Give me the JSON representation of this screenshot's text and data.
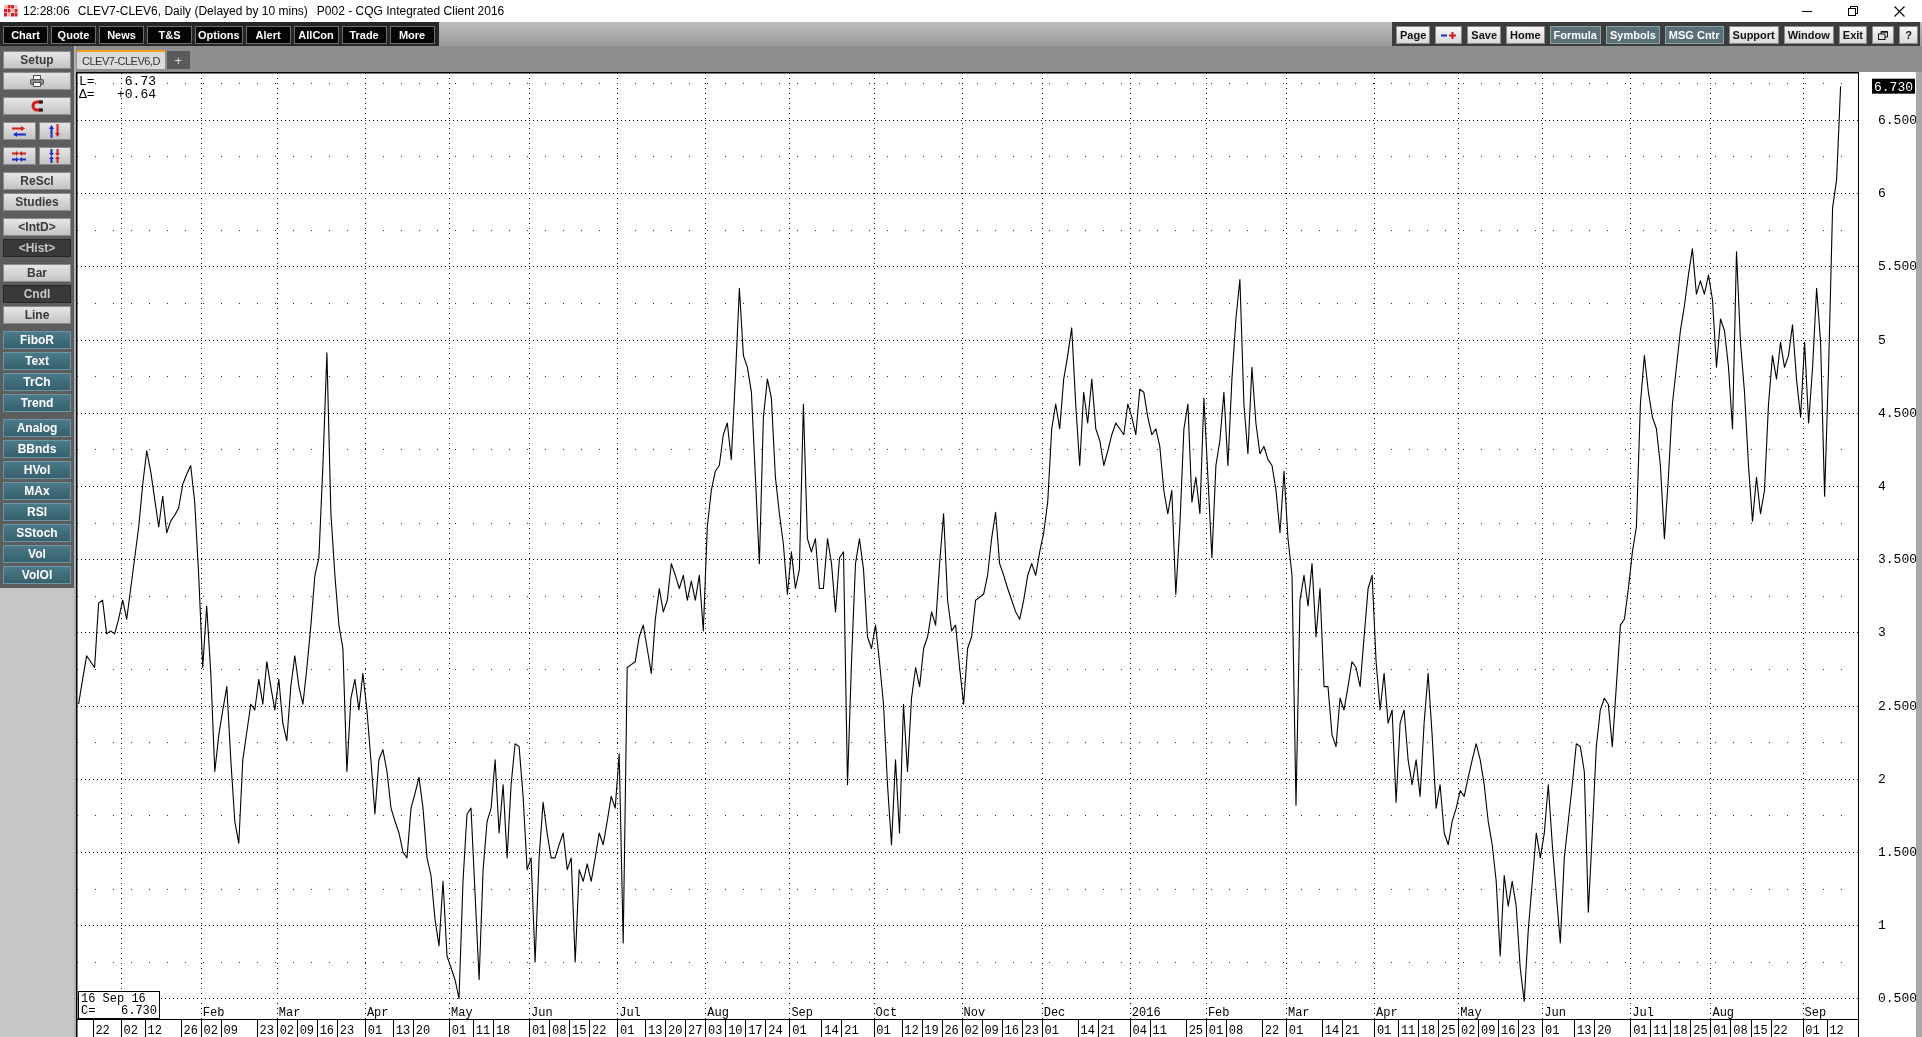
{
  "window": {
    "time": "12:28:06",
    "title": "CLEV7-CLEV6, Daily (Delayed by 10 mins)",
    "app": "P002 - CQG Integrated Client 2016"
  },
  "menu": [
    "Chart",
    "Quote",
    "News",
    "T&S",
    "Options",
    "Alert",
    "AllCon",
    "Trade",
    "More"
  ],
  "toolbar": [
    {
      "kind": "text",
      "label": "Page",
      "active": false
    },
    {
      "kind": "icon",
      "active": false
    },
    {
      "kind": "text",
      "label": "Save",
      "active": false
    },
    {
      "kind": "text",
      "label": "Home",
      "active": false
    },
    {
      "kind": "text",
      "label": "Formula",
      "active": true
    },
    {
      "kind": "text",
      "label": "Symbols",
      "active": true
    },
    {
      "kind": "text",
      "label": "MSG Cntr",
      "active": true
    },
    {
      "kind": "text",
      "label": "Support",
      "active": false
    },
    {
      "kind": "text",
      "label": "Window",
      "active": false
    },
    {
      "kind": "text",
      "label": "Exit",
      "active": false
    },
    {
      "kind": "icon",
      "active": false
    },
    {
      "kind": "text",
      "label": "?",
      "active": false
    }
  ],
  "tabs": [
    {
      "label": "CLEV7-CLEV6,D",
      "selected": true
    }
  ],
  "new_tab": "+",
  "sidebar": [
    {
      "kind": "plain",
      "buttons": [
        {
          "kind": "text",
          "label": "Setup"
        },
        {
          "kind": "icon"
        }
      ]
    },
    {
      "kind": "plain",
      "buttons": [
        {
          "kind": "icon"
        }
      ]
    },
    {
      "kind": "row",
      "buttons": [
        {
          "kind": "icon"
        },
        {
          "kind": "icon"
        }
      ]
    },
    {
      "kind": "row",
      "buttons": [
        {
          "kind": "icon"
        },
        {
          "kind": "icon"
        }
      ]
    },
    {
      "kind": "plain",
      "buttons": [
        {
          "kind": "text",
          "label": "ReScl"
        },
        {
          "kind": "text",
          "label": "Studies"
        }
      ]
    },
    {
      "kind": "mode",
      "buttons": [
        {
          "kind": "text",
          "label": "<IntD>",
          "selected": false
        },
        {
          "kind": "text",
          "label": "<Hist>",
          "selected": true
        }
      ]
    },
    {
      "kind": "mode",
      "buttons": [
        {
          "kind": "text",
          "label": "Bar",
          "selected": false
        },
        {
          "kind": "text",
          "label": "Cndl",
          "selected": true
        },
        {
          "kind": "text",
          "label": "Line",
          "selected": false
        }
      ]
    },
    {
      "kind": "tool",
      "buttons": [
        {
          "kind": "text",
          "label": "FiboR"
        },
        {
          "kind": "text",
          "label": "Text"
        },
        {
          "kind": "text",
          "label": "TrCh"
        },
        {
          "kind": "text",
          "label": "Trend"
        }
      ]
    },
    {
      "kind": "tool",
      "buttons": [
        {
          "kind": "text",
          "label": "Analog"
        },
        {
          "kind": "text",
          "label": "BBnds"
        },
        {
          "kind": "text",
          "label": "HVol"
        },
        {
          "kind": "text",
          "label": "MAx"
        },
        {
          "kind": "text",
          "label": "RSI"
        },
        {
          "kind": "text",
          "label": "SStoch"
        },
        {
          "kind": "text",
          "label": "Vol"
        },
        {
          "kind": "text",
          "label": "VolOI"
        }
      ]
    }
  ],
  "chart": {
    "readout": [
      {
        "label": "L=",
        "value": "6.73"
      },
      {
        "label": "Δ=",
        "value": "+0.64"
      }
    ],
    "cursor": {
      "date": "16 Sep 16",
      "label": "C=",
      "value": "6.730"
    },
    "last_price": "6.730",
    "chart_data": {
      "type": "line",
      "grid": true,
      "categories": [
        null,
        null,
        null,
        null,
        null,
        null,
        "22",
        null,
        null,
        null,
        null,
        null,
        null,
        "02",
        null,
        null,
        null,
        null,
        null,
        "12",
        null,
        null,
        null,
        null,
        null,
        null,
        null,
        null,
        "26",
        null,
        null,
        null,
        null,
        "02",
        null,
        null,
        null,
        null,
        "09",
        null,
        null,
        null,
        null,
        null,
        null,
        null,
        null,
        "23",
        null,
        null,
        null,
        null,
        "02",
        null,
        null,
        null,
        null,
        "09",
        null,
        null,
        null,
        null,
        "16",
        null,
        null,
        null,
        null,
        "23",
        null,
        null,
        null,
        null,
        null,
        null,
        "01",
        null,
        null,
        null,
        null,
        null,
        null,
        "13",
        null,
        null,
        null,
        null,
        "20",
        null,
        null,
        null,
        null,
        null,
        null,
        null,
        null,
        "01",
        null,
        null,
        null,
        null,
        null,
        "11",
        null,
        null,
        null,
        null,
        "18",
        null,
        null,
        null,
        null,
        null,
        null,
        null,
        null,
        "01",
        null,
        null,
        null,
        null,
        "08",
        null,
        null,
        null,
        null,
        "15",
        null,
        null,
        null,
        null,
        "22",
        null,
        null,
        null,
        null,
        null,
        null,
        "01",
        null,
        null,
        null,
        null,
        null,
        null,
        "13",
        null,
        null,
        null,
        null,
        "20",
        null,
        null,
        null,
        null,
        "27",
        null,
        null,
        null,
        null,
        "03",
        null,
        null,
        null,
        null,
        "10",
        null,
        null,
        null,
        null,
        "17",
        null,
        null,
        null,
        null,
        "24",
        null,
        null,
        null,
        null,
        null,
        "01",
        null,
        null,
        null,
        null,
        null,
        null,
        null,
        "14",
        null,
        null,
        null,
        null,
        "21",
        null,
        null,
        null,
        null,
        null,
        null,
        null,
        "01",
        null,
        null,
        null,
        null,
        null,
        null,
        "12",
        null,
        null,
        null,
        null,
        "19",
        null,
        null,
        null,
        null,
        "26",
        null,
        null,
        null,
        null,
        "02",
        null,
        null,
        null,
        null,
        "09",
        null,
        null,
        null,
        null,
        "16",
        null,
        null,
        null,
        null,
        "23",
        null,
        null,
        null,
        null,
        "01",
        null,
        null,
        null,
        null,
        null,
        null,
        null,
        null,
        "14",
        null,
        null,
        null,
        null,
        "21",
        null,
        null,
        null,
        null,
        null,
        null,
        null,
        "04",
        null,
        null,
        null,
        null,
        "11",
        null,
        null,
        null,
        null,
        null,
        null,
        null,
        null,
        "25",
        null,
        null,
        null,
        null,
        "01",
        null,
        null,
        null,
        null,
        "08",
        null,
        null,
        null,
        null,
        null,
        null,
        null,
        null,
        "22",
        null,
        null,
        null,
        null,
        null,
        "01",
        null,
        null,
        null,
        null,
        null,
        null,
        null,
        null,
        "14",
        null,
        null,
        null,
        null,
        "21",
        null,
        null,
        null,
        null,
        null,
        null,
        null,
        "01",
        null,
        null,
        null,
        null,
        null,
        "11",
        null,
        null,
        null,
        null,
        "18",
        null,
        null,
        null,
        null,
        "25",
        null,
        null,
        null,
        null,
        "02",
        null,
        null,
        null,
        null,
        "09",
        null,
        null,
        null,
        null,
        "16",
        null,
        null,
        null,
        null,
        "23",
        null,
        null,
        null,
        null,
        null,
        "01",
        null,
        null,
        null,
        null,
        null,
        null,
        null,
        "13",
        null,
        null,
        null,
        null,
        "20",
        null,
        null,
        null,
        null,
        null,
        null,
        null,
        null,
        "01",
        null,
        null,
        null,
        null,
        "11",
        null,
        null,
        null,
        null,
        "18",
        null,
        null,
        null,
        null,
        "25",
        null,
        null,
        null,
        null,
        "01",
        null,
        null,
        null,
        null,
        "08",
        null,
        null,
        null,
        null,
        "15",
        null,
        null,
        null,
        null,
        "22",
        null,
        null,
        null,
        null,
        null,
        null,
        null,
        "01",
        null,
        null,
        null,
        null,
        null,
        "12",
        null
      ],
      "values": [
        2.51,
        2.68,
        2.84,
        2.8,
        2.76,
        3.2,
        3.22,
        2.99,
        3.01,
        2.99,
        3.09,
        3.22,
        3.09,
        3.3,
        3.51,
        3.72,
        4.01,
        4.24,
        4.1,
        3.91,
        3.72,
        3.93,
        3.68,
        3.76,
        3.8,
        3.85,
        4.01,
        4.08,
        4.14,
        3.89,
        3.39,
        2.76,
        3.18,
        2.72,
        2.05,
        2.3,
        2.47,
        2.63,
        2.13,
        1.71,
        1.56,
        2.13,
        2.32,
        2.51,
        2.47,
        2.68,
        2.51,
        2.8,
        2.63,
        2.47,
        2.68,
        2.38,
        2.26,
        2.63,
        2.84,
        2.63,
        2.51,
        2.76,
        3.05,
        3.39,
        3.51,
        4.14,
        4.91,
        3.81,
        3.39,
        3.05,
        2.89,
        2.05,
        2.55,
        2.68,
        2.47,
        2.72,
        2.47,
        2.13,
        1.76,
        2.13,
        2.2,
        2.05,
        1.8,
        1.71,
        1.63,
        1.5,
        1.46,
        1.8,
        1.9,
        2.01,
        1.8,
        1.46,
        1.34,
        1.04,
        0.86,
        1.3,
        0.79,
        0.71,
        0.63,
        0.5,
        1.3,
        1.76,
        1.8,
        1.21,
        0.63,
        1.38,
        1.71,
        1.8,
        2.13,
        1.63,
        1.96,
        1.46,
        1.96,
        2.24,
        2.22,
        1.88,
        1.38,
        1.46,
        0.75,
        1.46,
        1.84,
        1.63,
        1.46,
        1.46,
        1.55,
        1.63,
        1.38,
        1.46,
        0.75,
        1.38,
        1.3,
        1.42,
        1.3,
        1.46,
        1.63,
        1.55,
        1.71,
        1.88,
        1.8,
        2.17,
        0.88,
        2.76,
        2.78,
        2.8,
        2.97,
        3.05,
        2.89,
        2.72,
        3.09,
        3.3,
        3.14,
        3.22,
        3.47,
        3.39,
        3.3,
        3.39,
        3.22,
        3.35,
        3.22,
        3.39,
        3.01,
        3.72,
        3.97,
        4.1,
        4.14,
        4.35,
        4.43,
        4.18,
        4.73,
        5.35,
        4.89,
        4.81,
        4.64,
        4.06,
        3.47,
        4.47,
        4.73,
        4.6,
        4.06,
        3.81,
        3.6,
        3.26,
        3.55,
        3.3,
        3.43,
        4.56,
        3.64,
        3.55,
        3.64,
        3.3,
        3.3,
        3.64,
        3.47,
        3.14,
        3.51,
        3.55,
        1.96,
        2.8,
        3.47,
        3.64,
        3.43,
        2.97,
        2.89,
        3.05,
        2.8,
        2.51,
        1.96,
        1.55,
        2.13,
        1.63,
        2.51,
        2.05,
        2.55,
        2.76,
        2.63,
        2.89,
        2.97,
        3.14,
        3.05,
        3.47,
        3.81,
        3.22,
        3.01,
        3.05,
        2.76,
        2.51,
        2.89,
        2.97,
        3.22,
        3.24,
        3.26,
        3.39,
        3.64,
        3.82,
        3.47,
        3.39,
        3.3,
        3.22,
        3.14,
        3.09,
        3.22,
        3.39,
        3.47,
        3.39,
        3.55,
        3.68,
        3.89,
        4.39,
        4.56,
        4.39,
        4.73,
        4.89,
        5.08,
        4.56,
        4.14,
        4.64,
        4.43,
        4.73,
        4.39,
        4.31,
        4.14,
        4.24,
        4.35,
        4.43,
        4.39,
        4.35,
        4.56,
        4.47,
        4.35,
        4.66,
        4.64,
        4.47,
        4.35,
        4.39,
        4.27,
        3.97,
        3.81,
        3.97,
        3.26,
        3.72,
        4.39,
        4.56,
        3.89,
        4.06,
        3.81,
        4.6,
        4.06,
        3.51,
        4.14,
        4.31,
        4.64,
        4.14,
        4.73,
        5.14,
        5.41,
        4.56,
        4.22,
        4.81,
        4.43,
        4.22,
        4.27,
        4.18,
        4.14,
        3.97,
        3.68,
        4.1,
        3.64,
        3.39,
        1.82,
        3.22,
        3.39,
        3.18,
        3.47,
        2.97,
        3.3,
        2.63,
        2.63,
        2.3,
        2.22,
        2.55,
        2.47,
        2.63,
        2.8,
        2.76,
        2.63,
        2.97,
        3.3,
        3.39,
        2.8,
        2.47,
        2.72,
        2.38,
        2.47,
        1.84,
        2.38,
        2.47,
        2.13,
        1.96,
        2.13,
        1.88,
        2.38,
        2.72,
        2.3,
        1.8,
        1.96,
        1.63,
        1.55,
        1.71,
        1.8,
        1.92,
        1.88,
        2.01,
        2.13,
        2.24,
        2.13,
        1.96,
        1.71,
        1.55,
        1.3,
        0.79,
        1.34,
        1.13,
        1.3,
        1.13,
        0.71,
        0.48,
        0.96,
        1.3,
        1.63,
        1.46,
        1.63,
        1.96,
        1.55,
        1.21,
        0.88,
        1.46,
        1.71,
        1.96,
        2.24,
        2.22,
        2.05,
        1.09,
        1.63,
        2.22,
        2.47,
        2.55,
        2.51,
        2.22,
        2.63,
        3.05,
        3.09,
        3.3,
        3.55,
        3.72,
        4.56,
        4.89,
        4.64,
        4.47,
        4.39,
        4.14,
        3.64,
        4.06,
        4.56,
        4.81,
        5.06,
        5.23,
        5.44,
        5.62,
        5.31,
        5.4,
        5.31,
        5.44,
        5.27,
        4.81,
        5.14,
        5.06,
        4.81,
        4.39,
        5.6,
        4.98,
        4.64,
        4.14,
        3.76,
        4.06,
        3.81,
        3.97,
        4.56,
        4.89,
        4.73,
        4.98,
        4.81,
        4.89,
        5.1,
        4.73,
        4.47,
        4.98,
        4.43,
        4.81,
        5.35,
        4.98,
        3.93,
        4.81,
        5.9,
        6.09,
        6.73
      ],
      "ylim": [
        0.36,
        6.82
      ],
      "yticks": [
        {
          "value": 0.5,
          "label": "0.500"
        },
        {
          "value": 1,
          "label": "1"
        },
        {
          "value": 1.5,
          "label": "1.500"
        },
        {
          "value": 2,
          "label": "2"
        },
        {
          "value": 2.5,
          "label": "2.500"
        },
        {
          "value": 3,
          "label": "3"
        },
        {
          "value": 3.5,
          "label": "3.500"
        },
        {
          "value": 4,
          "label": "4"
        },
        {
          "value": 4.5,
          "label": "4.500"
        },
        {
          "value": 5,
          "label": "5"
        },
        {
          "value": 5.5,
          "label": "5.500"
        },
        {
          "value": 6,
          "label": "6"
        },
        {
          "value": 6.5,
          "label": "6.500"
        }
      ],
      "annotations": [
        "Feb",
        "Mar",
        "Apr",
        "May",
        "Jun",
        "Jul",
        "Aug",
        "Sep",
        "Oct",
        "Nov",
        "Dec",
        "2016",
        "Feb",
        "Mar",
        "Apr",
        "May",
        "Jun",
        "Jul",
        "Aug",
        "Sep"
      ]
    }
  }
}
